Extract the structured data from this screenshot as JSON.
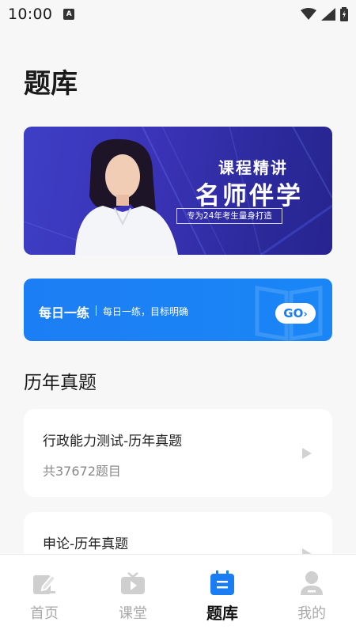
{
  "status_bar": {
    "time": "10:00",
    "notification_glyph": "A"
  },
  "page": {
    "title": "题库"
  },
  "banner": {
    "line1": "课程精讲",
    "line2": "名师伴学",
    "tag": "专为24年考生量身打造"
  },
  "daily": {
    "title": "每日一练",
    "subtitle": "每日一练，目标明确",
    "go_label": "GO",
    "go_icon": "chevron-right-icon"
  },
  "section": {
    "title": "历年真题"
  },
  "papers": [
    {
      "title": "行政能力测试-历年真题",
      "count": "共37672题目"
    },
    {
      "title": "申论-历年真题"
    }
  ],
  "tabbar": {
    "tabs": [
      {
        "label": "首页",
        "icon": "pencil-icon"
      },
      {
        "label": "课堂",
        "icon": "tv-play-icon"
      },
      {
        "label": "题库",
        "icon": "calendar-icon",
        "active": true
      },
      {
        "label": "我的",
        "icon": "person-icon"
      }
    ]
  },
  "colors": {
    "accent": "#1a7df3",
    "banner": "#3b33b8",
    "inactive_tab": "#aaaaaa"
  }
}
